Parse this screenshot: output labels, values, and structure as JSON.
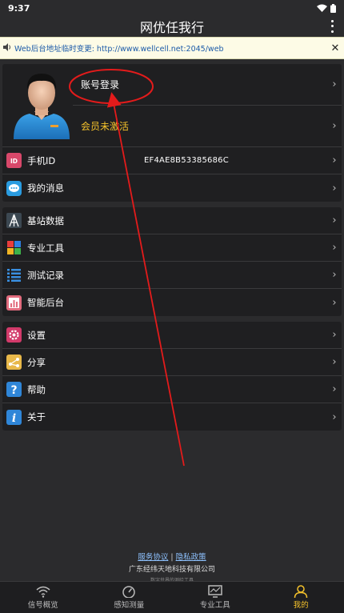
{
  "status_bar": {
    "time": "9:37"
  },
  "app_bar": {
    "title": "网优任我行"
  },
  "notice": {
    "text": "Web后台地址临时变更: http://www.wellcell.net:2045/web"
  },
  "profile": {
    "login_label": "账号登录",
    "member_status": "会员未激活"
  },
  "group1": [
    {
      "label": "手机ID",
      "value": "EF4AE8B53385686C",
      "icon": "id-icon"
    },
    {
      "label": "我的消息",
      "icon": "message-icon"
    }
  ],
  "group2": [
    {
      "label": "基站数据",
      "icon": "base-station-icon"
    },
    {
      "label": "专业工具",
      "icon": "tools-icon"
    },
    {
      "label": "测试记录",
      "icon": "list-icon"
    },
    {
      "label": "智能后台",
      "icon": "chart-icon"
    }
  ],
  "group3": [
    {
      "label": "设置",
      "icon": "gear-icon"
    },
    {
      "label": "分享",
      "icon": "share-icon"
    },
    {
      "label": "帮助",
      "icon": "help-icon"
    },
    {
      "label": "关于",
      "icon": "info-icon"
    }
  ],
  "footer": {
    "service_link": "服务协议",
    "separator": "|",
    "privacy_link": "隐私政策",
    "company": "广东经纬天地科技有限公司",
    "slogan": "数字世界的测绘工具"
  },
  "bottom_nav": [
    {
      "label": "信号概览",
      "icon": "signal-icon"
    },
    {
      "label": "感知测量",
      "icon": "speedometer-icon"
    },
    {
      "label": "专业工具",
      "icon": "monitor-icon"
    },
    {
      "label": "我的",
      "icon": "user-icon",
      "active": true
    }
  ],
  "colors": {
    "accent": "#f5c22b",
    "annotation": "#e31b1b",
    "background": "#2b2b2d"
  }
}
